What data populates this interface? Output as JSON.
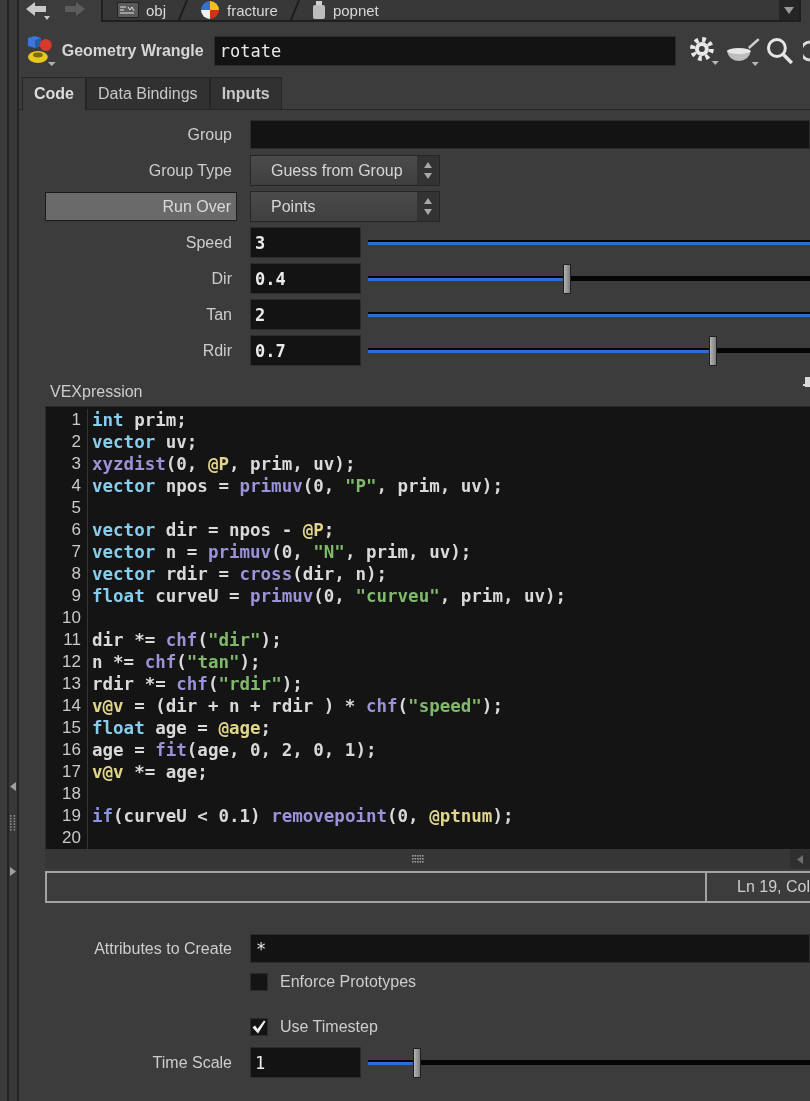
{
  "path_bar": {
    "crumbs": [
      {
        "label": "obj",
        "kind": "objects"
      },
      {
        "label": "fracture",
        "kind": "dynamics"
      },
      {
        "label": "popnet",
        "kind": "particles"
      }
    ]
  },
  "node": {
    "type_label": "Geometry Wrangle",
    "name": "rotate"
  },
  "tabs": [
    {
      "label": "Code",
      "selected": true,
      "modified": true
    },
    {
      "label": "Data Bindings",
      "selected": false,
      "modified": false
    },
    {
      "label": "Inputs",
      "selected": false,
      "modified": true
    }
  ],
  "params_top": [
    {
      "kind": "text",
      "label": "Group",
      "label_button": false
    },
    {
      "kind": "menu",
      "label": "Group Type",
      "label_button": false,
      "value": "Guess from Group"
    },
    {
      "kind": "menu",
      "label": "Run Over",
      "label_button": true,
      "value": "Points"
    },
    {
      "kind": "slider",
      "label": "Speed",
      "label_button": false,
      "value": "3",
      "modified": true,
      "level": 1
    },
    {
      "kind": "slider",
      "label": "Dir",
      "label_button": false,
      "value": "0.4",
      "modified": true,
      "level": 0.45
    },
    {
      "kind": "slider",
      "label": "Tan",
      "label_button": false,
      "value": "2",
      "modified": true,
      "level": 1
    },
    {
      "kind": "slider",
      "label": "Rdir",
      "label_button": false,
      "value": "0.7",
      "modified": true,
      "level": 0.78
    }
  ],
  "vex": {
    "label": "VEXpression",
    "lines": [
      {
        "number": "1",
        "tokens": [
          {
            "kind": "keyword",
            "text": "int"
          },
          {
            "kind": "plain",
            "text": " prim;"
          }
        ]
      },
      {
        "number": "2",
        "tokens": [
          {
            "kind": "keyword",
            "text": "vector"
          },
          {
            "kind": "plain",
            "text": " uv;"
          }
        ]
      },
      {
        "number": "3",
        "tokens": [
          {
            "kind": "function",
            "text": "xyzdist"
          },
          {
            "kind": "plain",
            "text": "(0, "
          },
          {
            "kind": "attribute",
            "text": "@P"
          },
          {
            "kind": "plain",
            "text": ", prim, uv);"
          }
        ]
      },
      {
        "number": "4",
        "tokens": [
          {
            "kind": "keyword",
            "text": "vector"
          },
          {
            "kind": "plain",
            "text": " npos = "
          },
          {
            "kind": "function",
            "text": "primuv"
          },
          {
            "kind": "plain",
            "text": "(0, "
          },
          {
            "kind": "string",
            "text": "\"P\""
          },
          {
            "kind": "plain",
            "text": ", prim, uv);"
          }
        ]
      },
      {
        "number": "5"
      },
      {
        "number": "6",
        "tokens": [
          {
            "kind": "keyword",
            "text": "vector"
          },
          {
            "kind": "plain",
            "text": " dir = npos - "
          },
          {
            "kind": "attribute",
            "text": "@P"
          },
          {
            "kind": "plain",
            "text": ";"
          }
        ]
      },
      {
        "number": "7",
        "tokens": [
          {
            "kind": "keyword",
            "text": "vector"
          },
          {
            "kind": "plain",
            "text": " n = "
          },
          {
            "kind": "function",
            "text": "primuv"
          },
          {
            "kind": "plain",
            "text": "(0, "
          },
          {
            "kind": "string",
            "text": "\"N\""
          },
          {
            "kind": "plain",
            "text": ", prim, uv);"
          }
        ]
      },
      {
        "number": "8",
        "tokens": [
          {
            "kind": "keyword",
            "text": "vector"
          },
          {
            "kind": "plain",
            "text": " rdir = "
          },
          {
            "kind": "function",
            "text": "cross"
          },
          {
            "kind": "plain",
            "text": "(dir, n);"
          }
        ]
      },
      {
        "number": "9",
        "tokens": [
          {
            "kind": "keyword",
            "text": "float"
          },
          {
            "kind": "plain",
            "text": " curveU = "
          },
          {
            "kind": "function",
            "text": "primuv"
          },
          {
            "kind": "plain",
            "text": "(0, "
          },
          {
            "kind": "string",
            "text": "\"curveu\""
          },
          {
            "kind": "plain",
            "text": ", prim, uv);"
          }
        ]
      },
      {
        "number": "10"
      },
      {
        "number": "11",
        "tokens": [
          {
            "kind": "plain",
            "text": "dir *= "
          },
          {
            "kind": "function",
            "text": "chf"
          },
          {
            "kind": "plain",
            "text": "("
          },
          {
            "kind": "string",
            "text": "\"dir\""
          },
          {
            "kind": "plain",
            "text": ");"
          }
        ]
      },
      {
        "number": "12",
        "tokens": [
          {
            "kind": "plain",
            "text": "n *= "
          },
          {
            "kind": "function",
            "text": "chf"
          },
          {
            "kind": "plain",
            "text": "("
          },
          {
            "kind": "string",
            "text": "\"tan\""
          },
          {
            "kind": "plain",
            "text": ");"
          }
        ]
      },
      {
        "number": "13",
        "tokens": [
          {
            "kind": "plain",
            "text": "rdir *= "
          },
          {
            "kind": "function",
            "text": "chf"
          },
          {
            "kind": "plain",
            "text": "("
          },
          {
            "kind": "string",
            "text": "\"rdir\""
          },
          {
            "kind": "plain",
            "text": ");"
          }
        ]
      },
      {
        "number": "14",
        "tokens": [
          {
            "kind": "attribute",
            "text": "v@v"
          },
          {
            "kind": "plain",
            "text": " = (dir + n + rdir ) * "
          },
          {
            "kind": "function",
            "text": "chf"
          },
          {
            "kind": "plain",
            "text": "("
          },
          {
            "kind": "string",
            "text": "\"speed\""
          },
          {
            "kind": "plain",
            "text": ");"
          }
        ]
      },
      {
        "number": "15",
        "tokens": [
          {
            "kind": "keyword",
            "text": "float"
          },
          {
            "kind": "plain",
            "text": " age = "
          },
          {
            "kind": "attribute",
            "text": "@age"
          },
          {
            "kind": "plain",
            "text": ";"
          }
        ]
      },
      {
        "number": "16",
        "tokens": [
          {
            "kind": "plain",
            "text": "age = "
          },
          {
            "kind": "function",
            "text": "fit"
          },
          {
            "kind": "plain",
            "text": "(age, 0, 2, 0, 1);"
          }
        ]
      },
      {
        "number": "17",
        "tokens": [
          {
            "kind": "attribute",
            "text": "v@v"
          },
          {
            "kind": "plain",
            "text": " *= age;"
          }
        ]
      },
      {
        "number": "18"
      },
      {
        "number": "19",
        "tokens": [
          {
            "kind": "control",
            "text": "if"
          },
          {
            "kind": "plain",
            "text": "(curveU < 0.1) "
          },
          {
            "kind": "function",
            "text": "removepoint"
          },
          {
            "kind": "plain",
            "text": "(0, "
          },
          {
            "kind": "attribute",
            "text": "@ptnum"
          },
          {
            "kind": "plain",
            "text": ");"
          }
        ]
      },
      {
        "number": "20"
      }
    ],
    "cursor_position": "Ln 19, Col"
  },
  "params_bottom": [
    {
      "kind": "text",
      "label": "Attributes to Create",
      "value": "*"
    },
    {
      "kind": "checkbox",
      "label": "Enforce Prototypes",
      "checked": false
    },
    {
      "kind": "checkbox",
      "label": "Use Timestep",
      "checked": true
    },
    {
      "kind": "slider",
      "label": "Time Scale",
      "value": "1",
      "modified": false,
      "level": 0.11
    }
  ]
}
